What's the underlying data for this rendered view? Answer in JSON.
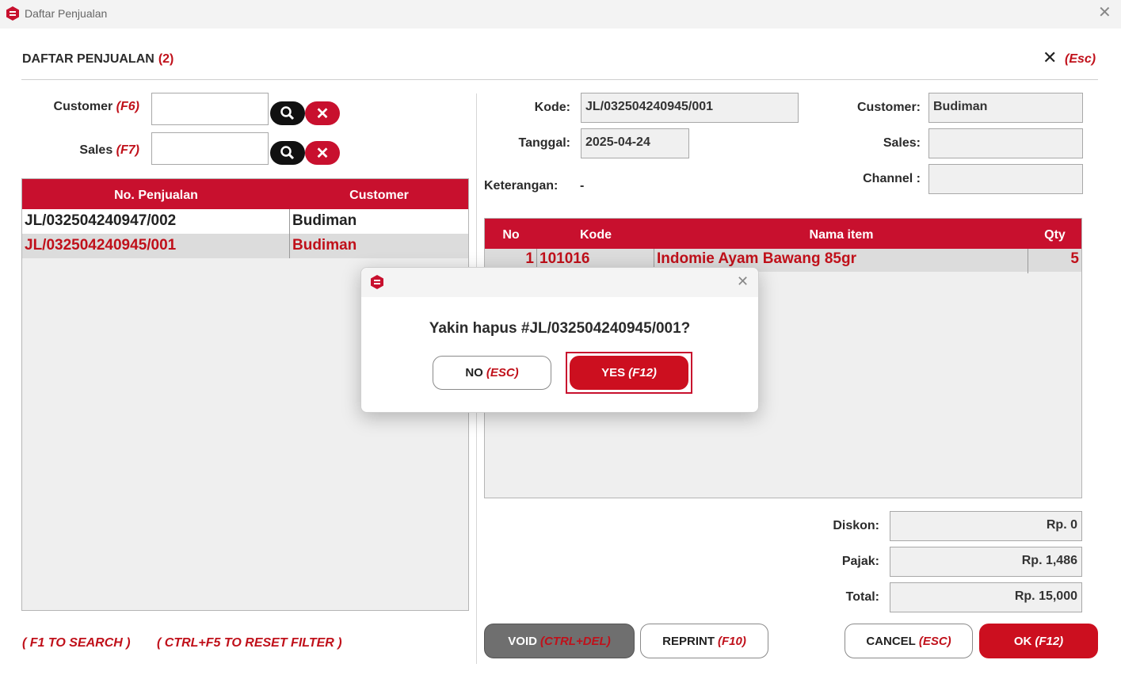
{
  "window": {
    "title": "Daftar Penjualan",
    "close_glyph": "✕"
  },
  "header": {
    "title": "DAFTAR PENJUALAN",
    "count": "(2)",
    "close_glyph": "✕",
    "close_key": "(Esc)"
  },
  "filters": {
    "customer_label": "Customer",
    "customer_key": "(F6)",
    "customer_value": "",
    "sales_label": "Sales",
    "sales_key": "(F7)",
    "sales_value": "",
    "clear_glyph": "✕"
  },
  "sales_list": {
    "columns": [
      "No. Penjualan",
      "Customer"
    ],
    "rows": [
      {
        "no": "JL/032504240947/002",
        "customer": "Budiman",
        "selected": false
      },
      {
        "no": "JL/032504240945/001",
        "customer": "Budiman",
        "selected": true
      }
    ]
  },
  "detail": {
    "kode_label": "Kode:",
    "kode_value": "JL/032504240945/001",
    "tanggal_label": "Tanggal:",
    "tanggal_value": "2025-04-24",
    "keterangan_label": "Keterangan:",
    "keterangan_value": "-",
    "customer_label": "Customer:",
    "customer_value": "Budiman",
    "sales_label": "Sales:",
    "sales_value": "",
    "channel_label": "Channel :",
    "channel_value": ""
  },
  "items": {
    "columns": [
      "No",
      "Kode",
      "Nama item",
      "Qty"
    ],
    "rows": [
      {
        "no": "1",
        "kode": "101016",
        "nama": "Indomie Ayam Bawang 85gr",
        "qty": "5"
      }
    ]
  },
  "totals": {
    "diskon_label": "Diskon:",
    "diskon_value": "Rp. 0",
    "pajak_label": "Pajak:",
    "pajak_value": "Rp. 1,486",
    "total_label": "Total:",
    "total_value": "Rp. 15,000"
  },
  "hints": {
    "search": "( F1 TO SEARCH )",
    "reset": "( CTRL+F5 TO RESET FILTER )"
  },
  "buttons": {
    "void_label": "VOID",
    "void_key": "(CTRL+DEL)",
    "reprint_label": "REPRINT",
    "reprint_key": "(F10)",
    "cancel_label": "CANCEL",
    "cancel_key": "(ESC)",
    "ok_label": "OK",
    "ok_key": "(F12)"
  },
  "dialog": {
    "message": "Yakin hapus #JL/032504240945/001?",
    "no_label": "NO",
    "no_key": "(ESC)",
    "yes_label": "YES",
    "yes_key": "(F12)",
    "close_glyph": "✕"
  },
  "colors": {
    "accent": "#c8102e",
    "accent_text": "#c0101a",
    "field_bg": "#f0f0f0",
    "void_bg": "#6f6f6f"
  }
}
